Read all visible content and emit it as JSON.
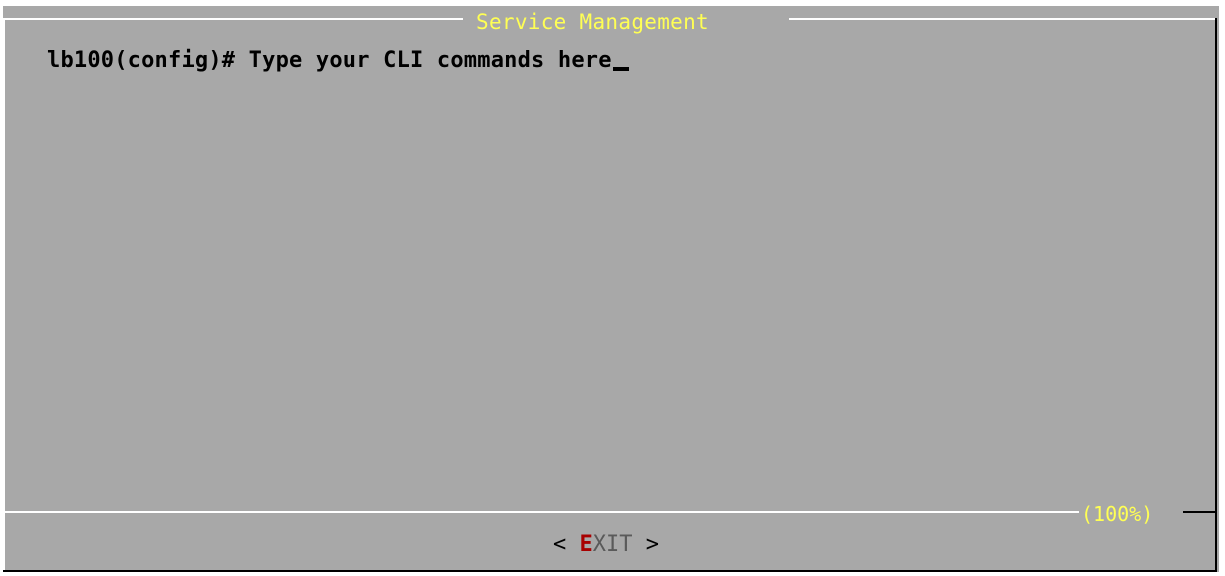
{
  "dialog": {
    "title": "Service Management",
    "scroll_percent": "(100%)"
  },
  "terminal": {
    "prompt_text": "lb100(config)# Type your CLI commands here"
  },
  "buttons": {
    "exit": {
      "left_bracket": "<",
      "hotkey": "E",
      "label_rest": "XIT",
      "right_bracket": ">"
    }
  },
  "colors": {
    "dialog_bg": "#a8a8a8",
    "title": "#ffff54",
    "hotkey": "#a80000",
    "text": "#000000"
  }
}
